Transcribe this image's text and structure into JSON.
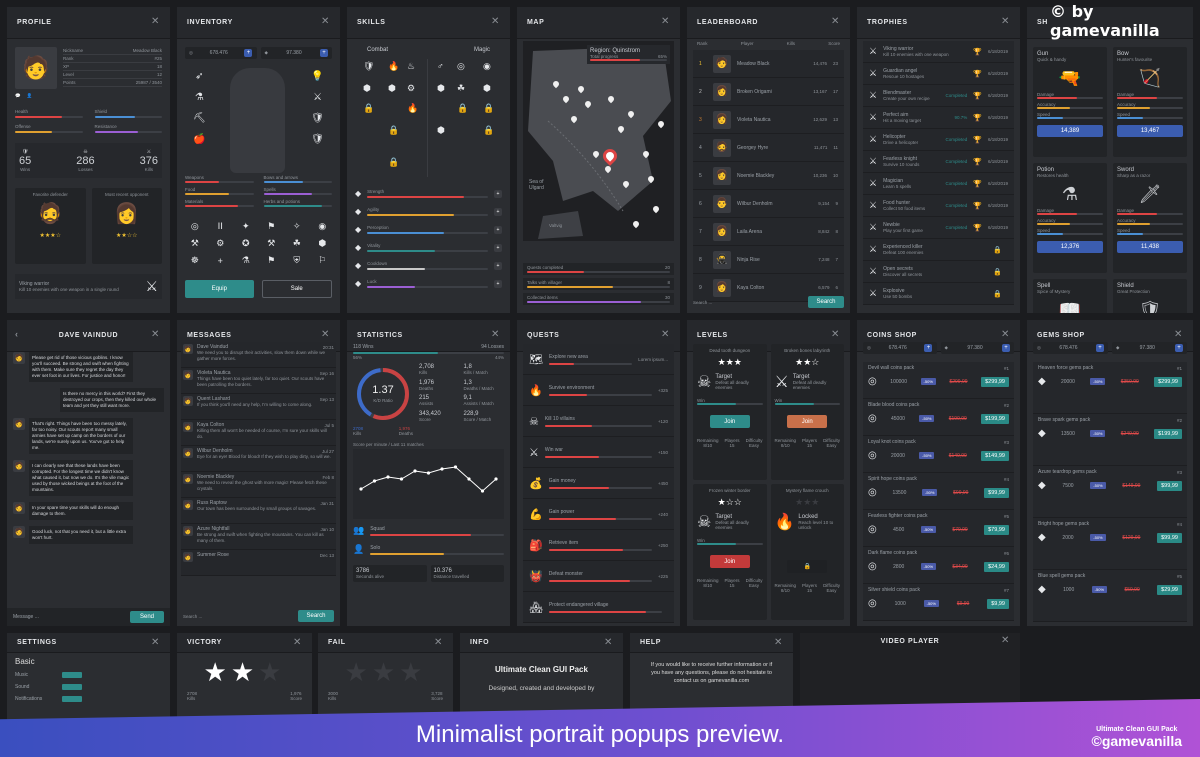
{
  "watermark": "© by gamevanilla",
  "banner": {
    "text": "Minimalist portrait popups preview.",
    "pack": "Ultimate Clean GUI Pack",
    "brand": "©gamevanilla"
  },
  "titles": {
    "profile": "PROFILE",
    "inventory": "INVENTORY",
    "skills": "SKILLS",
    "map": "MAP",
    "leaderboard": "LEADERBOARD",
    "trophies": "TROPHIES",
    "shop": "SH",
    "chat": "DAVE VAINDUD",
    "messages": "MESSAGES",
    "statistics": "STATISTICS",
    "quests": "QUESTS",
    "levels": "LEVELS",
    "coins_shop": "COINS SHOP",
    "gems_shop": "GEMS SHOP",
    "settings": "SETTINGS",
    "victory": "VICTORY",
    "fail": "FAIL",
    "info": "INFO",
    "help": "HELP",
    "video": "VIDEO PLAYER"
  },
  "profile": {
    "fields": [
      [
        "Nickname",
        "Meadow Black"
      ],
      [
        "Rank",
        "#25"
      ],
      [
        "XP",
        "18"
      ],
      [
        "Level",
        "12"
      ],
      [
        "Points",
        "25987 / 3540"
      ]
    ],
    "stats_a": [
      [
        "Health",
        ""
      ],
      [
        "Shield",
        ""
      ]
    ],
    "stats_b": [
      [
        "Offense",
        ""
      ],
      [
        "Resistance",
        ""
      ]
    ],
    "numbers": [
      [
        "65",
        "Wins"
      ],
      [
        "286",
        "Losses"
      ],
      [
        "376",
        "Kills"
      ]
    ],
    "fav": "Favorite defender",
    "enemy": "Most recent opponent",
    "mini": [
      "24",
      "3"
    ],
    "ach_title": "Viking warrior",
    "ach_sub": "Kill 10 enemies with one weapon in a single round"
  },
  "inventory": {
    "coins": "678.476",
    "gems": "97.380",
    "equip": "Equip",
    "sale": "Sale",
    "stats": [
      [
        "Weapons",
        ""
      ],
      [
        "Bows and arrows",
        ""
      ],
      [
        "Food",
        ""
      ],
      [
        "Spells",
        ""
      ],
      [
        "Materials",
        ""
      ],
      [
        "Herbs and potions",
        ""
      ]
    ]
  },
  "skills": {
    "tabs": [
      "Combat",
      "Magic"
    ],
    "bars": [
      "Strength",
      "Agility",
      "Perception",
      "Vitality",
      "Cooldown",
      "Luck"
    ]
  },
  "map": {
    "region": "Region: Quinstrom",
    "progress": "Total progress",
    "pct": "65%",
    "sea": "Sea of Ulgard",
    "area": "Valtvig",
    "quests": [
      [
        "Quests completed",
        "20"
      ],
      [
        "Talks with villager",
        "8"
      ],
      [
        "Collected items",
        "30"
      ]
    ]
  },
  "leaderboard": {
    "cols": [
      "Rank",
      "Player",
      "Kills",
      "Score"
    ],
    "search": "Search ...",
    "btn": "Search",
    "rows": [
      [
        "1",
        "Meadow Black",
        "14,476",
        "23"
      ],
      [
        "2",
        "Broken Origami",
        "13,167",
        "17"
      ],
      [
        "3",
        "Violeta Nautica",
        "12,629",
        "13"
      ],
      [
        "4",
        "Georgey Hyre",
        "11,471",
        "11"
      ],
      [
        "5",
        "Noemie Blackley",
        "10,236",
        "10"
      ],
      [
        "6",
        "Wilbur Denholm",
        "9,154",
        "9"
      ],
      [
        "7",
        "Laila Arena",
        "8,842",
        "8"
      ],
      [
        "8",
        "Ninja Rise",
        "7,248",
        "7"
      ],
      [
        "9",
        "Kaya Colton",
        "6,579",
        "6"
      ]
    ]
  },
  "trophies": {
    "rows": [
      [
        "Viking warrior",
        "Kill 10 enemies with one weapon",
        "",
        "6/18/2019"
      ],
      [
        "Guardian angel",
        "Rescue 10 hostages",
        "",
        "6/18/2019"
      ],
      [
        "Blendmaster",
        "Create your own recipe",
        "Completed",
        "6/18/2019"
      ],
      [
        "Perfect aim",
        "Hit a moving target",
        "90.7%",
        "6/18/2019"
      ],
      [
        "Helicopter",
        "Drive a helicopter",
        "Completed",
        "6/18/2019"
      ],
      [
        "Fearless knight",
        "Survive 10 rounds",
        "Completed",
        "6/18/2019"
      ],
      [
        "Magician",
        "Learn 5 spells",
        "Completed",
        "6/18/2019"
      ],
      [
        "Food hunter",
        "Collect 50 food items",
        "Completed",
        "6/18/2019"
      ],
      [
        "Newbie",
        "Play your first game",
        "Completed",
        "6/18/2019"
      ],
      [
        "Experienced killer",
        "Defeat 100 enemies",
        "",
        ""
      ],
      [
        "Open secrets",
        "Discover all secrets",
        "",
        ""
      ],
      [
        "Explosive",
        "Use 50 bombs",
        "",
        ""
      ]
    ]
  },
  "shop": {
    "items": [
      [
        "Gun",
        "Quick & handy",
        "14,389"
      ],
      [
        "Bow",
        "Hunter's favourite",
        "13,467"
      ],
      [
        "Potion",
        "Restores health",
        "12,376"
      ],
      [
        "Sword",
        "Sharp as a razor",
        "11,438"
      ],
      [
        "Spell",
        "Spice of Mystery",
        ""
      ],
      [
        "Shield",
        "Great Protection",
        ""
      ]
    ],
    "stats": [
      "Damage",
      "Accuracy",
      "Speed"
    ]
  },
  "chat": {
    "msgs": [
      [
        "in",
        "Please get rid of those vicious goblins. I know you'll succeed. Be strong and swift when fighting with them. Make sure they regret the day they ever set foot in our lives. For justice and honor!"
      ],
      [
        "out",
        "Is there no mercy in this world? First they destroyed our crops, then they killed our whole team and yet they still want more."
      ],
      [
        "in",
        "That's right. Things have been too messy lately, far too noisy. Our scouts report many small armies have set up camp on the borders of our lands, we're surely upon us. You've got to help me."
      ],
      [
        "in",
        "I can clearly see that these lands have been corrupted. For the longest time we didn't know what caused it, but now we do. It's the vile magic used by those wicked beings at the foot of the mountains."
      ],
      [
        "in",
        "In your spare time your skills will do enough damage to them."
      ],
      [
        "in",
        "Good luck, not that you need it, but a little extra won't hurt."
      ]
    ],
    "placeholder": "Message ...",
    "send": "Send",
    "time": "23:01"
  },
  "messages": {
    "rows": [
      [
        "Dave Vaindud",
        "We need you to disrupt their activities, slow them down while we gather more forces.",
        "20:31"
      ],
      [
        "Violeta Nautica",
        "Things have been too quiet lately, far too quiet. Our scouts have been patrolling the borders.",
        "Sep 16"
      ],
      [
        "Quent Lashard",
        "If you think you'll need any help, I'm willing to come along.",
        "Sep 13"
      ],
      [
        "Kaya Colton",
        "Killing them all won't be needed of course, I'm sure your skills will do.",
        "Jul 5"
      ],
      [
        "Wilbur Denholm",
        "Eye for an eye! Blood for blood! If they wish to play dirty, so will we.",
        "Jul 27"
      ],
      [
        "Noemie Blackley",
        "We need to reveal the ghost with more magic! Please fetch these crystals.",
        "Feb 8"
      ],
      [
        "Russ Raptow",
        "Our town has been surrounded by small groups of savages.",
        "Jan 31"
      ],
      [
        "Azure Nightfall",
        "Be strong and swift when fighting the mountains. You can kill as many of them.",
        "Jan 10"
      ],
      [
        "Summer Rose",
        "",
        "Dec 13"
      ]
    ],
    "search": "Search ...",
    "btn": "Search"
  },
  "statistics": {
    "wins": "118 Wins",
    "losses": "94 Losses",
    "pct1": "56%",
    "pct2": "44%",
    "kd": "1.37",
    "kd_sub": "K/D Ratio",
    "nums": [
      [
        "2,708",
        "Kills"
      ],
      [
        "1,8",
        "Kills / Match"
      ],
      [
        "1,976",
        "Deaths"
      ],
      [
        "1,3",
        "Deaths / Match"
      ],
      [
        "215",
        "Assists"
      ],
      [
        "9,1",
        "Assists / Match"
      ],
      [
        "343,420",
        "Score"
      ],
      [
        "228,9",
        "Score / Match"
      ]
    ],
    "k1": [
      "2708",
      "Kills"
    ],
    "k2": [
      "1,976",
      "Deaths"
    ],
    "chart_title": "Score per minute / Last 11 matches",
    "modes": [
      [
        "Squad",
        ""
      ],
      [
        "Solo",
        ""
      ]
    ],
    "bottom": [
      [
        "3786",
        "Seconds alive"
      ],
      [
        "10.376",
        "Distance travelled"
      ]
    ]
  },
  "quests": {
    "rows": [
      [
        "Explore new area",
        "Lorem ipsum...",
        "65%"
      ],
      [
        "Survive environment",
        "+325",
        "Complete"
      ],
      [
        "Kill 10 villains",
        "+120",
        ""
      ],
      [
        "Win war",
        "+150",
        ""
      ],
      [
        "Gain money",
        "+450",
        ""
      ],
      [
        "Gain power",
        "+240",
        ""
      ],
      [
        "Retrieve item",
        "+250",
        ""
      ],
      [
        "Defeat monster",
        "+225",
        ""
      ],
      [
        "Protect endangered village",
        "",
        ""
      ]
    ]
  },
  "levels": {
    "cards": [
      [
        "Dead tooth dungeon",
        "Target",
        "Defeat all deadly enemies",
        "Join"
      ],
      [
        "Broken bones labyrinth",
        "Target",
        "Defeat all deadly enemies",
        "Join"
      ],
      [
        "Frozen winter border",
        "Target",
        "Defeat all deadly enemies",
        "Join"
      ],
      [
        "Mystery flame crouch",
        "Locked",
        "Reach level 10 to unlock",
        ""
      ]
    ],
    "win": "Win",
    "foot": [
      [
        "Remaining",
        "8/10"
      ],
      [
        "Players",
        "15"
      ],
      [
        "Difficulty",
        "Easy"
      ]
    ]
  },
  "coins": {
    "coins": "678.476",
    "gems": "97.380",
    "rows": [
      [
        "Devil wall coins pack",
        "#1",
        "100000",
        "$299,99",
        "$299,99"
      ],
      [
        "Blade blood coins pack",
        "#2",
        "45000",
        "$199,99",
        "$199,99"
      ],
      [
        "Loyal knot coins pack",
        "#3",
        "20000",
        "$149,99",
        "$149,99"
      ],
      [
        "Spirit hope coins pack",
        "#4",
        "13500",
        "$99,99",
        "$99,99"
      ],
      [
        "Fearless fighter coins pack",
        "#5",
        "4500",
        "$79,99",
        "$79,99"
      ],
      [
        "Dark flame coins pack",
        "#6",
        "2800",
        "$34,99",
        "$24,99"
      ],
      [
        "Silver shield coins pack",
        "#7",
        "1000",
        "$9,99",
        "$9,99"
      ]
    ],
    "tag": "-50%"
  },
  "gems": {
    "coins": "678.476",
    "gems": "97.380",
    "rows": [
      [
        "Heaven force gems pack",
        "#1",
        "20000",
        "$359,99",
        "$299,99"
      ],
      [
        "Brave spark gems pack",
        "#2",
        "13500",
        "$249,99",
        "$199,99"
      ],
      [
        "Azure teardrop gems pack",
        "#3",
        "7500",
        "$149,99",
        "$99,99"
      ],
      [
        "Bright hope gems pack",
        "#4",
        "2000",
        "$129,99",
        "$99,99"
      ],
      [
        "Blue spell gems pack",
        "#5",
        "1000",
        "$59,99",
        "$29,99"
      ]
    ],
    "tag": "-50%"
  },
  "settings": {
    "section": "Basic",
    "items": [
      "Music",
      "Sound",
      "Notifications"
    ]
  },
  "victory": {
    "nums": [
      [
        "2708",
        "Kills"
      ],
      [
        "1,976",
        "Score"
      ]
    ]
  },
  "fail": {
    "nums": [
      [
        "3000",
        "Kills"
      ],
      [
        "3,728",
        "Score"
      ]
    ]
  },
  "info": {
    "title": "Ultimate Clean GUI Pack",
    "line": "Designed, created and developed by"
  },
  "help": {
    "text": "If you would like to receive further information or if you have any questions, please do not hesitate to contact us on gamevanilla.com"
  }
}
